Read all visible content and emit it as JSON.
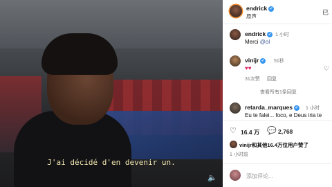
{
  "video": {
    "subtitle": "J'ai décidé d'en devenir un.",
    "volume_icon": "speaker-icon"
  },
  "post": {
    "author": "endrick",
    "audio_label": "原声",
    "more_glyph": "已"
  },
  "comments": [
    {
      "user": "endrick",
      "time": "1 小时",
      "text_prefix": "Merci ",
      "mention": "@ol"
    },
    {
      "user": "vinijr",
      "time": "51秒",
      "text": "♥♥",
      "likes": "31次赞",
      "reply": "回复"
    }
  ],
  "view_replies": "查看所有1条回复",
  "comment3": {
    "user": "retarda_marques",
    "time": "1 小时",
    "text": "Eu te falei... foco, e Deus iria te"
  },
  "stats": {
    "likes": "16.4 万",
    "comments": "2,768"
  },
  "liked_by": {
    "text": "vinijr和其他16.4万位用户赞了",
    "time": "1 小时前"
  },
  "input": {
    "placeholder": "添加评论..."
  }
}
